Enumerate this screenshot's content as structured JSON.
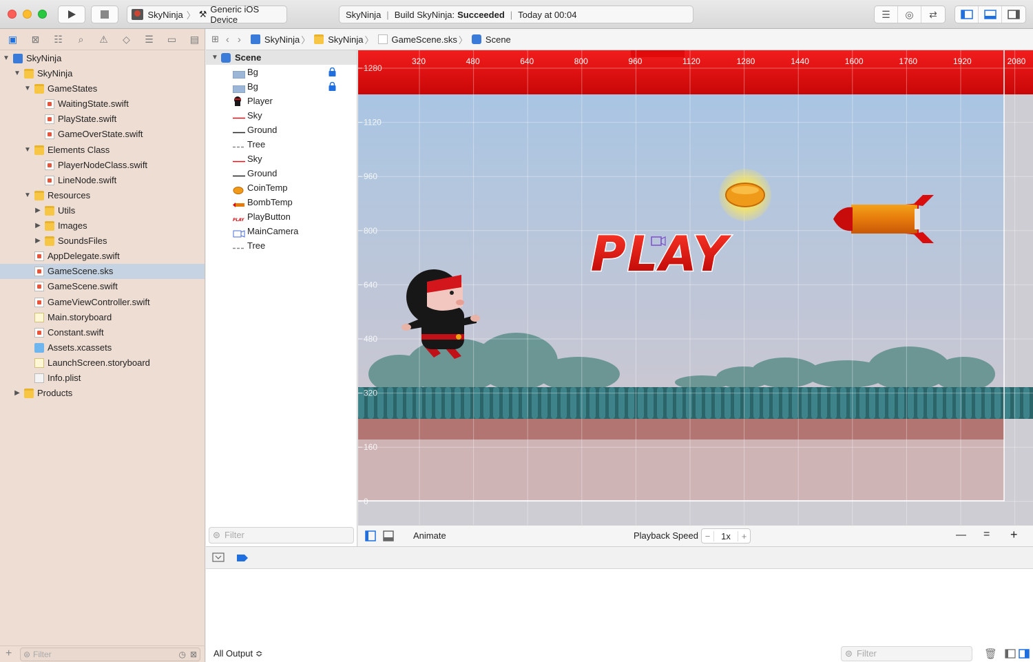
{
  "toolbar": {
    "scheme_name": "SkyNinja",
    "device": "Generic iOS Device",
    "status_project": "SkyNinja",
    "status_build_label": "Build SkyNinja:",
    "status_build_result": "Succeeded",
    "status_time": "Today at 00:04"
  },
  "navigator": {
    "items": [
      {
        "label": "SkyNinja",
        "depth": 0,
        "type": "project",
        "expanded": true
      },
      {
        "label": "SkyNinja",
        "depth": 1,
        "type": "folder",
        "expanded": true
      },
      {
        "label": "GameStates",
        "depth": 2,
        "type": "folder",
        "expanded": true
      },
      {
        "label": "WaitingState.swift",
        "depth": 3,
        "type": "swift"
      },
      {
        "label": "PlayState.swift",
        "depth": 3,
        "type": "swift"
      },
      {
        "label": "GameOverState.swift",
        "depth": 3,
        "type": "swift"
      },
      {
        "label": "Elements Class",
        "depth": 2,
        "type": "folder",
        "expanded": true
      },
      {
        "label": "PlayerNodeClass.swift",
        "depth": 3,
        "type": "swift"
      },
      {
        "label": "LineNode.swift",
        "depth": 3,
        "type": "swift"
      },
      {
        "label": "Resources",
        "depth": 2,
        "type": "folder",
        "expanded": true
      },
      {
        "label": "Utils",
        "depth": 3,
        "type": "folder",
        "expanded": false
      },
      {
        "label": "Images",
        "depth": 3,
        "type": "folder",
        "expanded": false
      },
      {
        "label": "SoundsFiles",
        "depth": 3,
        "type": "folder",
        "expanded": false
      },
      {
        "label": "AppDelegate.swift",
        "depth": 2,
        "type": "swift"
      },
      {
        "label": "GameScene.sks",
        "depth": 2,
        "type": "sks",
        "selected": true
      },
      {
        "label": "GameScene.swift",
        "depth": 2,
        "type": "swift"
      },
      {
        "label": "GameViewController.swift",
        "depth": 2,
        "type": "swift"
      },
      {
        "label": "Main.storyboard",
        "depth": 2,
        "type": "storyboard"
      },
      {
        "label": "Constant.swift",
        "depth": 2,
        "type": "swift"
      },
      {
        "label": "Assets.xcassets",
        "depth": 2,
        "type": "assets"
      },
      {
        "label": "LaunchScreen.storyboard",
        "depth": 2,
        "type": "storyboard"
      },
      {
        "label": "Info.plist",
        "depth": 2,
        "type": "plist"
      },
      {
        "label": "Products",
        "depth": 1,
        "type": "folder",
        "expanded": false
      }
    ],
    "filter_placeholder": "Filter"
  },
  "jumpbar": {
    "crumbs": [
      "SkyNinja",
      "SkyNinja",
      "GameScene.sks",
      "Scene"
    ]
  },
  "outline": {
    "root": "Scene",
    "items": [
      {
        "label": "Bg",
        "icon": "image-icon",
        "locked": true
      },
      {
        "label": "Bg",
        "icon": "image-icon",
        "locked": true
      },
      {
        "label": "Player",
        "icon": "ninja-icon",
        "locked": false
      },
      {
        "label": "Sky",
        "icon": "red-line-icon",
        "locked": false
      },
      {
        "label": "Ground",
        "icon": "black-line-icon",
        "locked": false
      },
      {
        "label": "Tree",
        "icon": "dashed-line-icon",
        "locked": false
      },
      {
        "label": "Sky",
        "icon": "red-line-icon",
        "locked": false
      },
      {
        "label": "Ground",
        "icon": "black-line-icon",
        "locked": false
      },
      {
        "label": "CoinTemp",
        "icon": "coin-icon",
        "locked": false
      },
      {
        "label": "BombTemp",
        "icon": "bomb-icon",
        "locked": false
      },
      {
        "label": "PlayButton",
        "icon": "play-label-icon",
        "locked": false
      },
      {
        "label": "MainCamera",
        "icon": "camera-icon",
        "locked": false
      },
      {
        "label": "Tree",
        "icon": "dashed-line-icon",
        "locked": false
      }
    ],
    "filter_placeholder": "Filter"
  },
  "scene": {
    "x_ruler": [
      "320",
      "480",
      "640",
      "800",
      "960",
      "1120",
      "1280",
      "1440",
      "1600",
      "1760",
      "1920",
      "2080"
    ],
    "y_ruler": [
      "1280",
      "1120",
      "960",
      "800",
      "640",
      "480",
      "320",
      "160",
      "0"
    ],
    "play_text": "PLAY"
  },
  "scene_controls": {
    "animate_label": "Animate",
    "playback_label": "Playback Speed",
    "speed_value": "1x",
    "zoom_out": "—",
    "zoom_fit": "=",
    "zoom_in": "+"
  },
  "console": {
    "output_selector": "All Output ≎",
    "filter_placeholder": "Filter"
  },
  "colors": {
    "accent": "#1f6fe0",
    "nav_bg": "#eeddd3",
    "sky_top": "#a9c5e3",
    "sky_bottom": "#c4c7d4",
    "red_band": "#d8090c",
    "ground_stripe": "#b27571"
  }
}
